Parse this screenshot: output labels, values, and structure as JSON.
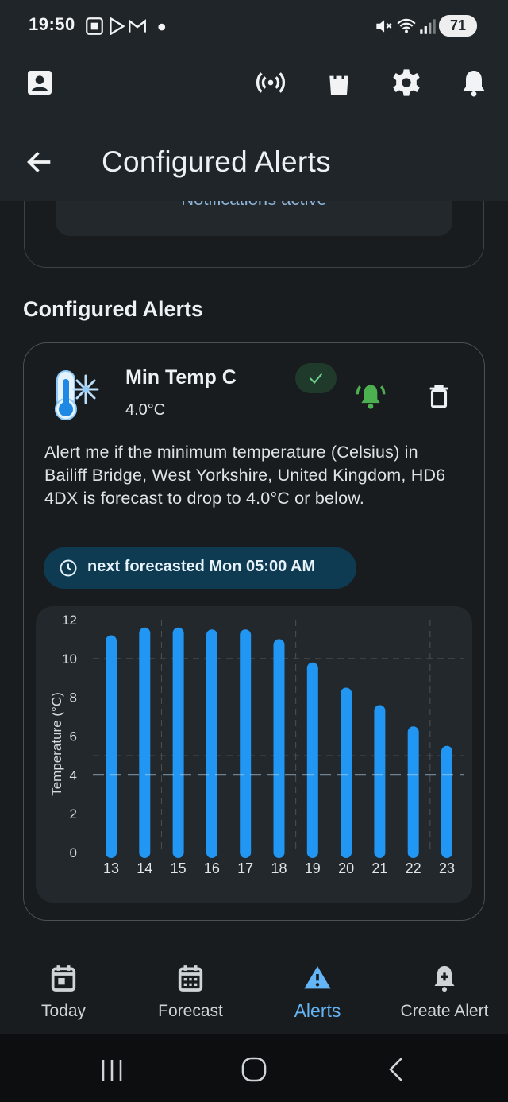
{
  "status_bar": {
    "time": "19:50",
    "battery": "71",
    "icons": [
      "screenshot-icon",
      "play-store-icon",
      "gmail-icon",
      "dot-icon",
      "mute-icon",
      "wifi-icon",
      "signal-icon"
    ]
  },
  "app_bar": {
    "title": "Configured Alerts",
    "icons": [
      "account-icon",
      "broadcast-icon",
      "shopping-bag-icon",
      "settings-icon",
      "bell-icon",
      "back-arrow-icon"
    ]
  },
  "previous_card": {
    "status_text": "Notifications active"
  },
  "section_title": "Configured Alerts",
  "alert": {
    "name": "Min Temp C",
    "threshold": "4.0°C",
    "description": "Alert me if the minimum temperature (Celsius) in Bailiff Bridge, West Yorkshire, United Kingdom, HD6 4DX is forecast to drop to 4.0°C or below.",
    "next_label": "next forecasted Mon 05:00 AM",
    "icons": [
      "thermometer-snowflake-icon",
      "check-icon",
      "alarm-bell-icon",
      "trash-icon",
      "clock-icon"
    ],
    "colors": {
      "accent": "#2196f3",
      "active_bell": "#4caf50",
      "chip_bg": "#0e3a52"
    }
  },
  "chart_data": {
    "type": "bar",
    "categories": [
      "13",
      "14",
      "15",
      "16",
      "17",
      "18",
      "19",
      "20",
      "21",
      "22",
      "23"
    ],
    "values": [
      11.2,
      11.6,
      11.6,
      11.5,
      11.5,
      11.0,
      9.8,
      8.5,
      7.6,
      6.5,
      5.5
    ],
    "ylabel": "Temperature (°C)",
    "yticks": [
      "0",
      "2",
      "4",
      "6",
      "8",
      "10",
      "12"
    ],
    "ylim": [
      0,
      12
    ],
    "threshold": 4.0,
    "grid": true,
    "bar_color": "#2196f3"
  },
  "bottom_nav": {
    "items": [
      {
        "label": "Today",
        "icon": "calendar-day-icon",
        "active": false
      },
      {
        "label": "Forecast",
        "icon": "calendar-grid-icon",
        "active": false
      },
      {
        "label": "Alerts",
        "icon": "warning-icon",
        "active": true
      },
      {
        "label": "Create Alert",
        "icon": "bell-plus-icon",
        "active": false
      }
    ],
    "active_color": "#64b5f6"
  },
  "system_nav": {
    "icons": [
      "recents-icon",
      "home-icon",
      "back-icon"
    ]
  }
}
